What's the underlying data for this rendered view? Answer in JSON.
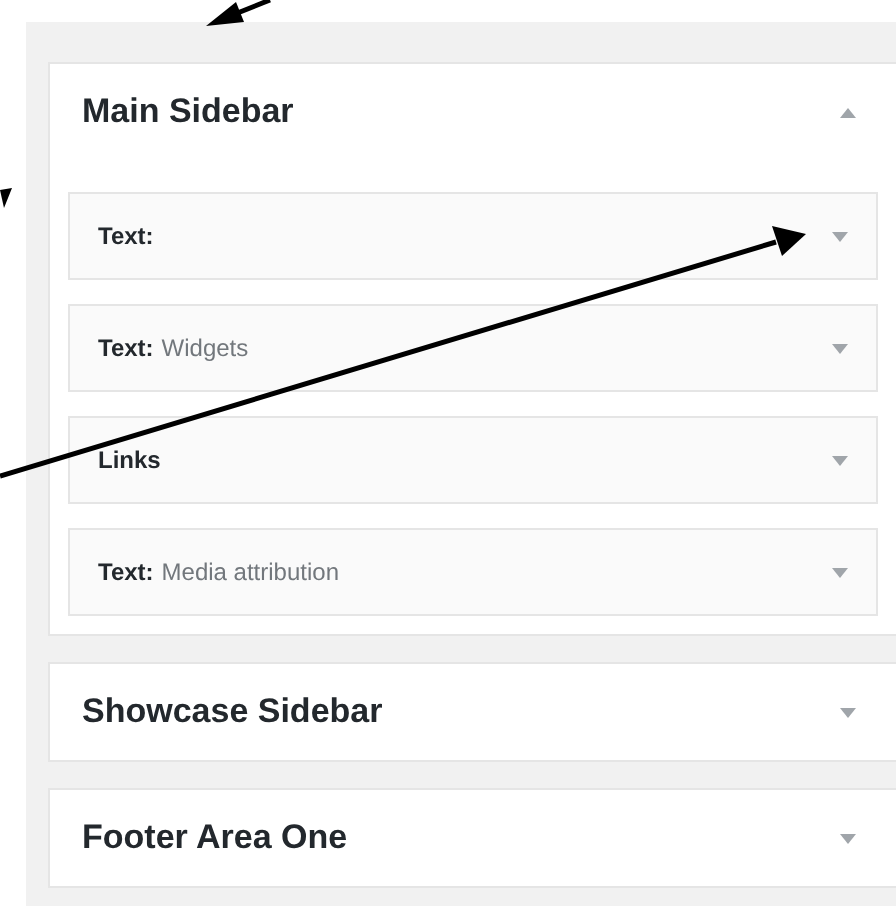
{
  "sidebars": [
    {
      "title": "Main Sidebar",
      "expanded": true,
      "widgets": [
        {
          "name": "Text:",
          "expanded": false
        },
        {
          "name": "Text:",
          "detail": "Widgets",
          "expanded": false
        },
        {
          "name": "Links",
          "expanded": false
        },
        {
          "name": "Text:",
          "detail": "Media attribution",
          "expanded": false
        }
      ]
    },
    {
      "title": "Showcase Sidebar",
      "expanded": false
    },
    {
      "title": "Footer Area One",
      "expanded": false
    }
  ]
}
